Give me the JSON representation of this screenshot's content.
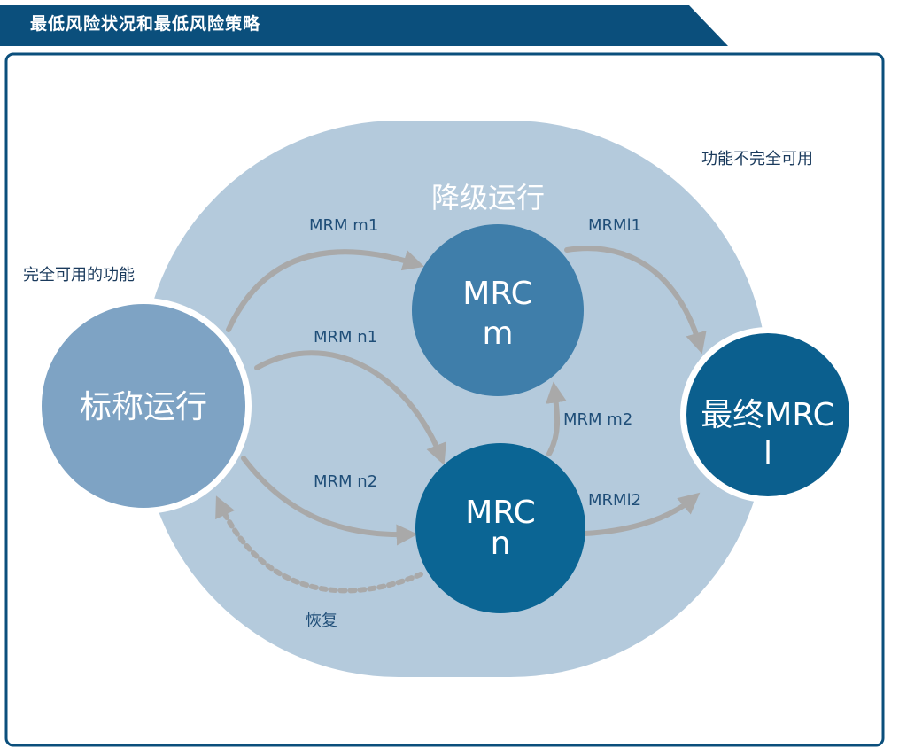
{
  "header": {
    "title": "最低风险状况和最低风险策略"
  },
  "diagram": {
    "zone_title": "降级运行",
    "zone_label": "功能不完全可用",
    "full_label": "完全可用的功能",
    "nodes": {
      "nominal": {
        "label": "标称运行"
      },
      "mrc_m": {
        "line1": "MRC",
        "line2": "m"
      },
      "mrc_n": {
        "line1": "MRC",
        "line2": "n"
      },
      "final": {
        "line1": "最终MRC",
        "line2": "l"
      }
    },
    "transitions": {
      "mrm_m1": "MRM m1",
      "mrm_n1": "MRM n1",
      "mrm_n2": "MRM n2",
      "mrm_m2": "MRM m2",
      "mrm_l1": "MRMl1",
      "mrm_l2": "MRMl2",
      "recover": "恢复"
    }
  },
  "colors": {
    "header": "#0b4f7c",
    "zone": "#b4cadc",
    "nominal": "#7ea3c4",
    "mrc_m": "#3f7eaa",
    "mrc_n": "#0b6594",
    "final": "#0b5f8e",
    "arrow": "#a9a9a9",
    "frame": "#0b4f7c"
  }
}
